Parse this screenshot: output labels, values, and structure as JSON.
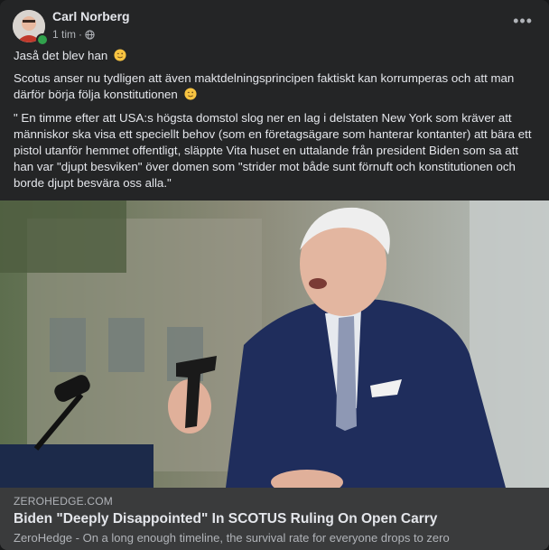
{
  "post": {
    "author": "Carl Norberg",
    "time": "1 tim",
    "separator": "·",
    "audience_icon": "globe-icon",
    "more_icon": "more-options-icon",
    "more_label": "•••",
    "paragraphs": [
      "Jaså det blev han",
      "Scotus anser nu tydligen att även maktdelningsprincipen faktiskt kan korrumperas och att man därför börja följa konstitutionen",
      "\" En timme efter att USA:s högsta domstol slog ner en lag i delstaten New York som kräver att människor ska visa ett speciellt behov (som en företagsägare som hanterar kontanter) att bära ett pistol utanför hemmet offentligt, släppte Vita huset en  uttalande  från president Biden som sa att han var \"djupt besviken\" över domen som \"strider mot både sunt förnuft och konstitutionen och borde djupt besvära oss alla.\""
    ],
    "emoji": "winking-face-emoji"
  },
  "link_preview": {
    "domain": "ZEROHEDGE.COM",
    "title": "Biden \"Deeply Disappointed\" In SCOTUS Ruling On Open Carry",
    "description": "ZeroHedge - On a long enough timeline, the survival rate for everyone drops to zero"
  },
  "colors": {
    "card_bg": "#242526",
    "link_bg": "#3a3b3c",
    "primary_text": "#e4e6eb",
    "secondary_text": "#b0b3b8",
    "online": "#31a24c",
    "suit": "#1f2d5c"
  }
}
